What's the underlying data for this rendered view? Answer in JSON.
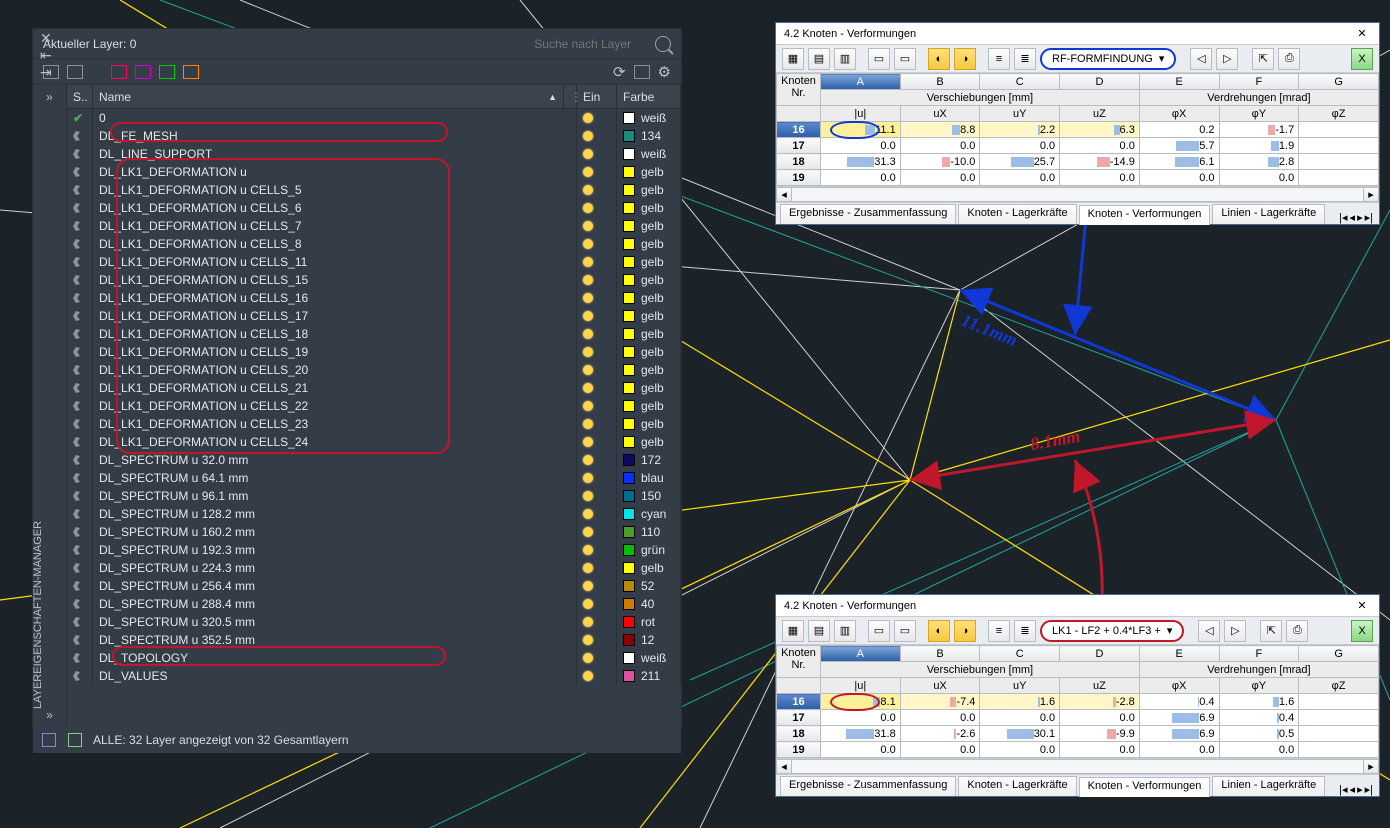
{
  "layer_panel": {
    "title": "Aktueller Layer: 0",
    "search_placeholder": "Suche nach Layer",
    "vtab_label": "LAYEREIGENSCHAFTEN-MANAGER",
    "columns": {
      "s": "S..",
      "name": "Name",
      "ein": "Ein",
      "farbe": "Farbe"
    },
    "footer": "ALLE: 32 Layer angezeigt von 32 Gesamtlayern",
    "layers": [
      {
        "name": "0",
        "color_label": "weiß",
        "swatch": "#ffffff",
        "current": true
      },
      {
        "name": "DL_FE_MESH",
        "color_label": "134",
        "swatch": "#1a8a7a"
      },
      {
        "name": "DL_LINE_SUPPORT",
        "color_label": "weiß",
        "swatch": "#ffffff"
      },
      {
        "name": "DL_LK1_DEFORMATION u",
        "color_label": "gelb",
        "swatch": "#ffff00"
      },
      {
        "name": "DL_LK1_DEFORMATION u CELLS_5",
        "color_label": "gelb",
        "swatch": "#ffff00"
      },
      {
        "name": "DL_LK1_DEFORMATION u CELLS_6",
        "color_label": "gelb",
        "swatch": "#ffff00"
      },
      {
        "name": "DL_LK1_DEFORMATION u CELLS_7",
        "color_label": "gelb",
        "swatch": "#ffff00"
      },
      {
        "name": "DL_LK1_DEFORMATION u CELLS_8",
        "color_label": "gelb",
        "swatch": "#ffff00"
      },
      {
        "name": "DL_LK1_DEFORMATION u CELLS_11",
        "color_label": "gelb",
        "swatch": "#ffff00"
      },
      {
        "name": "DL_LK1_DEFORMATION u CELLS_15",
        "color_label": "gelb",
        "swatch": "#ffff00"
      },
      {
        "name": "DL_LK1_DEFORMATION u CELLS_16",
        "color_label": "gelb",
        "swatch": "#ffff00"
      },
      {
        "name": "DL_LK1_DEFORMATION u CELLS_17",
        "color_label": "gelb",
        "swatch": "#ffff00"
      },
      {
        "name": "DL_LK1_DEFORMATION u CELLS_18",
        "color_label": "gelb",
        "swatch": "#ffff00"
      },
      {
        "name": "DL_LK1_DEFORMATION u CELLS_19",
        "color_label": "gelb",
        "swatch": "#ffff00"
      },
      {
        "name": "DL_LK1_DEFORMATION u CELLS_20",
        "color_label": "gelb",
        "swatch": "#ffff00"
      },
      {
        "name": "DL_LK1_DEFORMATION u CELLS_21",
        "color_label": "gelb",
        "swatch": "#ffff00"
      },
      {
        "name": "DL_LK1_DEFORMATION u CELLS_22",
        "color_label": "gelb",
        "swatch": "#ffff00"
      },
      {
        "name": "DL_LK1_DEFORMATION u CELLS_23",
        "color_label": "gelb",
        "swatch": "#ffff00"
      },
      {
        "name": "DL_LK1_DEFORMATION u CELLS_24",
        "color_label": "gelb",
        "swatch": "#ffff00"
      },
      {
        "name": "DL_SPECTRUM u  32.0 mm",
        "color_label": "172",
        "swatch": "#0a0a66"
      },
      {
        "name": "DL_SPECTRUM u  64.1 mm",
        "color_label": "blau",
        "swatch": "#0030ff"
      },
      {
        "name": "DL_SPECTRUM u  96.1 mm",
        "color_label": "150",
        "swatch": "#006c8f"
      },
      {
        "name": "DL_SPECTRUM u 128.2 mm",
        "color_label": "cyan",
        "swatch": "#00e5e5"
      },
      {
        "name": "DL_SPECTRUM u 160.2 mm",
        "color_label": "110",
        "swatch": "#4aa02c"
      },
      {
        "name": "DL_SPECTRUM u 192.3 mm",
        "color_label": "grün",
        "swatch": "#00c000"
      },
      {
        "name": "DL_SPECTRUM u 224.3 mm",
        "color_label": "gelb",
        "swatch": "#ffff00"
      },
      {
        "name": "DL_SPECTRUM u 256.4 mm",
        "color_label": "52",
        "swatch": "#b98b00"
      },
      {
        "name": "DL_SPECTRUM u 288.4 mm",
        "color_label": "40",
        "swatch": "#d17a00"
      },
      {
        "name": "DL_SPECTRUM u 320.5 mm",
        "color_label": "rot",
        "swatch": "#ff0000"
      },
      {
        "name": "DL_SPECTRUM u 352.5 mm",
        "color_label": "12",
        "swatch": "#8b0000"
      },
      {
        "name": "DL_TOPOLOGY",
        "color_label": "weiß",
        "swatch": "#ffffff"
      },
      {
        "name": "DL_VALUES",
        "color_label": "211",
        "swatch": "#e050a0"
      }
    ]
  },
  "results1": {
    "title": "4.2 Knoten - Verformungen",
    "combo": "RF-FORMFINDUNG",
    "headers": {
      "node_header": "Knoten",
      "node_nr": "Nr.",
      "group_disp": "Verschiebungen [mm]",
      "group_rot": "Verdrehungen [mrad]",
      "cols": [
        "A",
        "B",
        "C",
        "D",
        "E",
        "F",
        "G"
      ],
      "sub": [
        "|u|",
        "uX",
        "uY",
        "uZ",
        "φX",
        "φY",
        "φZ"
      ]
    },
    "rows": [
      {
        "nr": "16",
        "u": "11.1",
        "ux": "8.8",
        "uy": "2.2",
        "uz": "6.3",
        "px": "0.2",
        "py": "-1.7",
        "pz": "",
        "sel": true
      },
      {
        "nr": "17",
        "u": "0.0",
        "ux": "0.0",
        "uy": "0.0",
        "uz": "0.0",
        "px": "5.7",
        "py": "1.9",
        "pz": ""
      },
      {
        "nr": "18",
        "u": "31.3",
        "ux": "-10.0",
        "uy": "25.7",
        "uz": "-14.9",
        "px": "6.1",
        "py": "2.8",
        "pz": ""
      },
      {
        "nr": "19",
        "u": "0.0",
        "ux": "0.0",
        "uy": "0.0",
        "uz": "0.0",
        "px": "0.0",
        "py": "0.0",
        "pz": ""
      }
    ],
    "tabs": [
      "Ergebnisse - Zusammenfassung",
      "Knoten - Lagerkräfte",
      "Knoten - Verformungen",
      "Linien - Lagerkräfte"
    ]
  },
  "results2": {
    "title": "4.2 Knoten - Verformungen",
    "combo": "LK1 - LF2 + 0.4*LF3 +",
    "headers": {
      "node_header": "Knoten",
      "node_nr": "Nr.",
      "group_disp": "Verschiebungen [mm]",
      "group_rot": "Verdrehungen [mrad]",
      "cols": [
        "A",
        "B",
        "C",
        "D",
        "E",
        "F",
        "G"
      ],
      "sub": [
        "|u|",
        "uX",
        "uY",
        "uZ",
        "φX",
        "φY",
        "φZ"
      ]
    },
    "rows": [
      {
        "nr": "16",
        "u": "8.1",
        "ux": "-7.4",
        "uy": "1.6",
        "uz": "-2.8",
        "px": "0.4",
        "py": "1.6",
        "pz": "",
        "sel": true
      },
      {
        "nr": "17",
        "u": "0.0",
        "ux": "0.0",
        "uy": "0.0",
        "uz": "0.0",
        "px": "6.9",
        "py": "0.4",
        "pz": ""
      },
      {
        "nr": "18",
        "u": "31.8",
        "ux": "-2.6",
        "uy": "30.1",
        "uz": "-9.9",
        "px": "6.9",
        "py": "0.5",
        "pz": ""
      },
      {
        "nr": "19",
        "u": "0.0",
        "ux": "0.0",
        "uy": "0.0",
        "uz": "0.0",
        "px": "0.0",
        "py": "0.0",
        "pz": ""
      }
    ],
    "tabs": [
      "Ergebnisse - Zusammenfassung",
      "Knoten - Lagerkräfte",
      "Knoten - Verformungen",
      "Linien - Lagerkräfte"
    ]
  },
  "annotations": {
    "blue_label": "11.1mm",
    "red_label": "8.1mm"
  }
}
